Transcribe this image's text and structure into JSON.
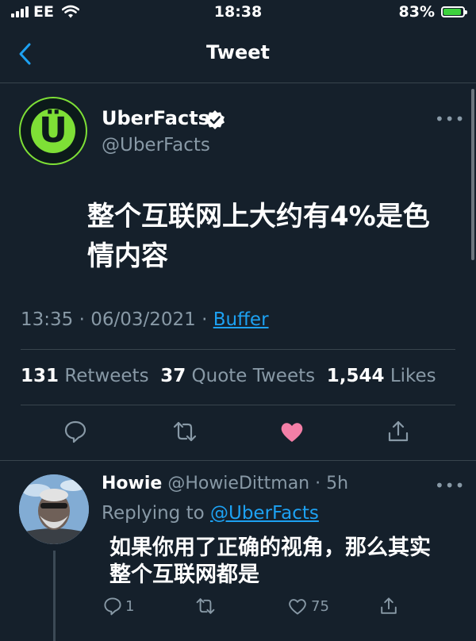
{
  "status_bar": {
    "carrier": "EE",
    "time": "18:38",
    "battery": "83%"
  },
  "nav": {
    "title": "Tweet",
    "back_icon": "chevron-left-icon"
  },
  "tweet": {
    "name": "UberFacts",
    "handle": "@UberFacts",
    "avatar_glyph": "Ü",
    "text": "整个互联网上大约有4%是色情内容",
    "time": "13:35 · 06/03/2021 · ",
    "source": "Buffer",
    "retweets": "131",
    "retweets_label": "Retweets",
    "quotes": "37",
    "quotes_label": "Quote Tweets",
    "likes": "1,544",
    "likes_label": "Likes",
    "liked": true,
    "colors": {
      "accent": "#1da1f2",
      "like": "#f91880",
      "background": "#15202b",
      "muted": "#8899a6"
    }
  },
  "reply": {
    "name": "Howie",
    "handle": "@HowieDittman",
    "time": "· 5h",
    "replying_prefix": "Replying to",
    "replying_to": "@UberFacts",
    "text": "如果你用了正确的视角，那么其实整个互联网都是",
    "reply_count": "1",
    "like_count": "75"
  }
}
